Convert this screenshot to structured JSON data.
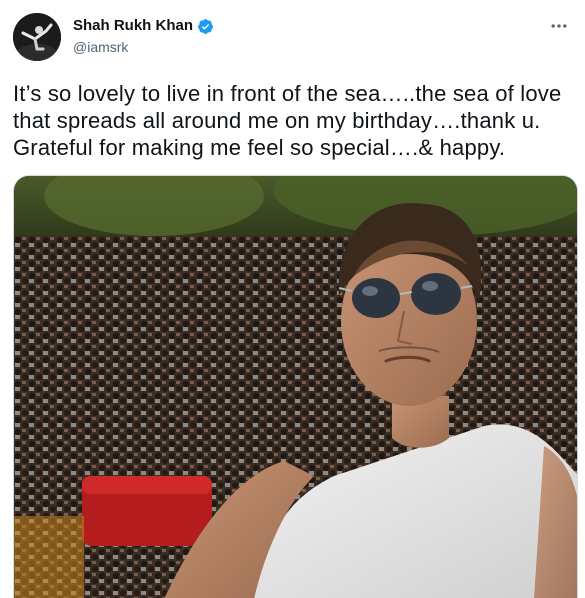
{
  "tweet": {
    "author": {
      "display_name": "Shah Rukh Khan",
      "handle": "@iamsrk",
      "verified": true
    },
    "text": "It’s so lovely to live in front of the sea…..the sea of love\nthat spreads all around me on my birthday….thank u.\nGrateful for making me feel so special….& happy.",
    "media": {
      "type": "photo",
      "subject": "selfie-with-crowd"
    }
  },
  "icons": {
    "verified": "verified-badge-icon",
    "more": "more-options-icon"
  },
  "colors": {
    "text_primary": "#0f1419",
    "text_secondary": "#536471",
    "verified_blue": "#1d9bf0",
    "border": "#cfd9de"
  }
}
